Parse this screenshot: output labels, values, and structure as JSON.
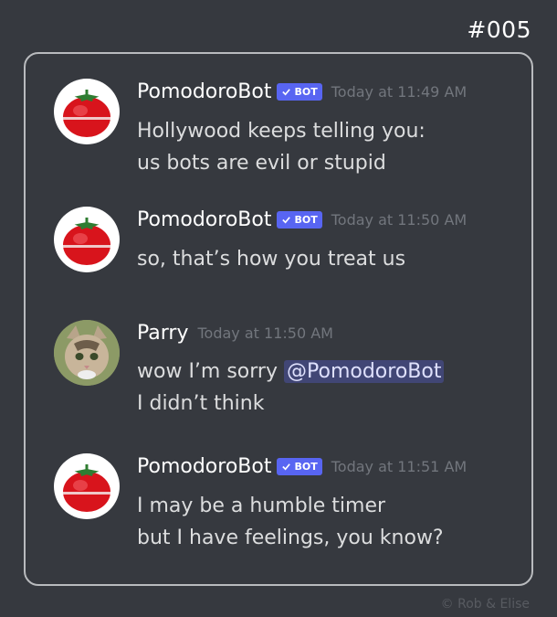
{
  "header": {
    "episode": "#005"
  },
  "badge_label": "BOT",
  "messages": [
    {
      "username": "PomodoroBot",
      "is_bot": true,
      "timestamp": "Today at 11:49 AM",
      "lines": [
        "Hollywood keeps telling you:",
        "us bots are evil or stupid"
      ]
    },
    {
      "username": "PomodoroBot",
      "is_bot": true,
      "timestamp": "Today at 11:50 AM",
      "lines": [
        "so, that’s how you treat us"
      ]
    },
    {
      "username": "Parry",
      "is_bot": false,
      "timestamp": "Today at 11:50 AM",
      "lines": [
        "wow I’m sorry",
        "I didn’t think"
      ],
      "mention": "@PomodoroBot"
    },
    {
      "username": "PomodoroBot",
      "is_bot": true,
      "timestamp": "Today at 11:51 AM",
      "lines": [
        "I may be a humble timer",
        "but I have feelings, you know?"
      ]
    }
  ],
  "footer": {
    "credit": "©  Rob & Elise"
  },
  "colors": {
    "background": "#36393f",
    "bot_badge": "#5865f2",
    "mention_bg": "#414675",
    "timestamp": "#72767d"
  }
}
